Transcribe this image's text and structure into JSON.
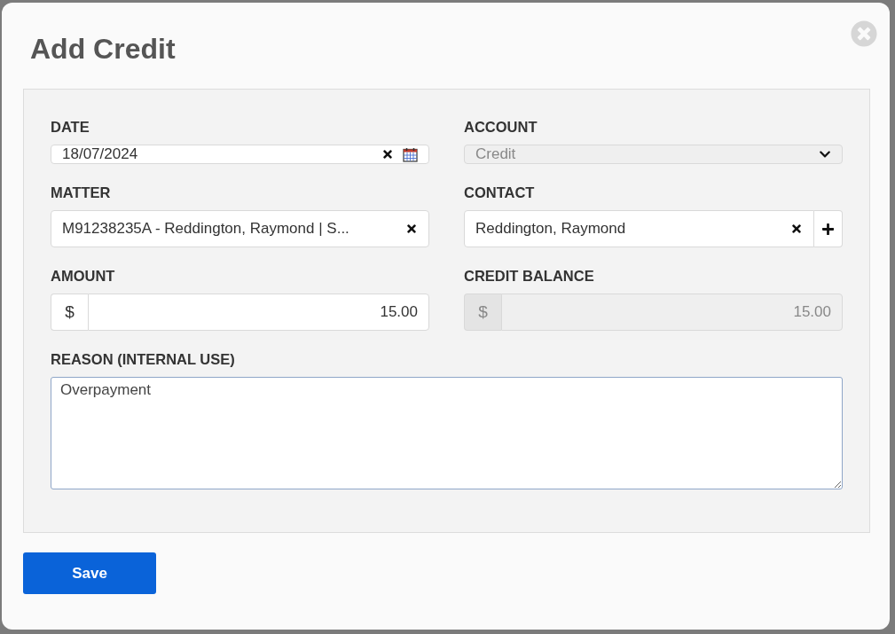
{
  "dialog": {
    "title": "Add Credit"
  },
  "fields": [
    {
      "kind": "date",
      "label": "DATE",
      "value": "18/07/2024",
      "disabled": false
    },
    {
      "kind": "select",
      "label": "ACCOUNT",
      "value": "Credit",
      "disabled": true
    },
    {
      "kind": "clearable",
      "label": "MATTER",
      "value": "M91238235A - Reddington, Raymond | S...",
      "disabled": false
    },
    {
      "kind": "contact",
      "label": "CONTACT",
      "value": "Reddington, Raymond",
      "disabled": false
    },
    {
      "kind": "currency",
      "label": "AMOUNT",
      "prefix": "$",
      "value": "15.00",
      "disabled": false
    },
    {
      "kind": "currency",
      "label": "CREDIT BALANCE",
      "prefix": "$",
      "value": "15.00",
      "disabled": true
    }
  ],
  "reason": {
    "label": "REASON (INTERNAL USE)",
    "value": "Overpayment"
  },
  "buttons": [
    {
      "label": "Save"
    }
  ]
}
